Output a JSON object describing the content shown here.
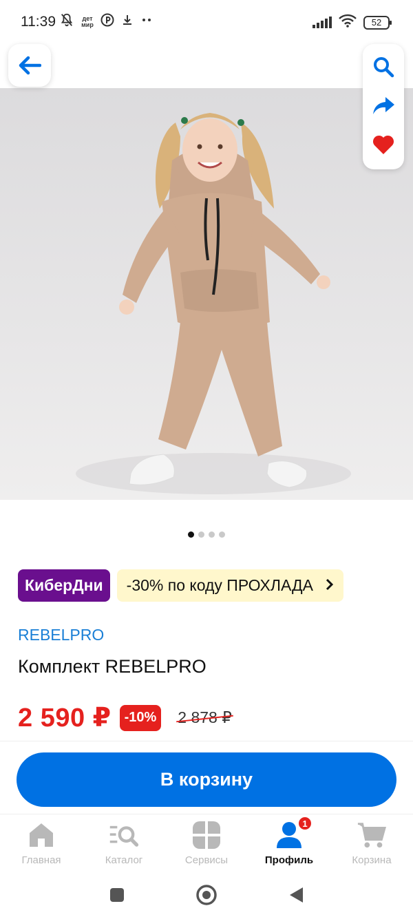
{
  "status_bar": {
    "time": "11:39",
    "notif_label": "дет мир",
    "battery": "52"
  },
  "product": {
    "promo_badge": "КиберДни",
    "promo_code_text": "-30% по коду ПРОХЛАДА",
    "brand": "REBELPRO",
    "title": "Комплект REBELPRO",
    "price": "2 590 ₽",
    "discount": "-10%",
    "old_price": "2 878 ₽",
    "image_page": 1,
    "image_count": 4
  },
  "cart_button": {
    "label": "В корзину"
  },
  "bottom_nav": {
    "items": [
      {
        "label": "Главная"
      },
      {
        "label": "Каталог"
      },
      {
        "label": "Сервисы"
      },
      {
        "label": "Профиль",
        "badge": "1"
      },
      {
        "label": "Корзина"
      }
    ]
  },
  "colors": {
    "accent": "#0071e3",
    "price_red": "#e5211e",
    "cyber_purple": "#6a0f8e",
    "promo_yellow": "#fff7cc",
    "brand_blue": "#1a7fd6"
  },
  "icons": [
    "back-arrow-icon",
    "search-icon",
    "share-icon",
    "heart-icon",
    "home-icon",
    "catalog-icon",
    "services-icon",
    "profile-icon",
    "cart-icon"
  ]
}
